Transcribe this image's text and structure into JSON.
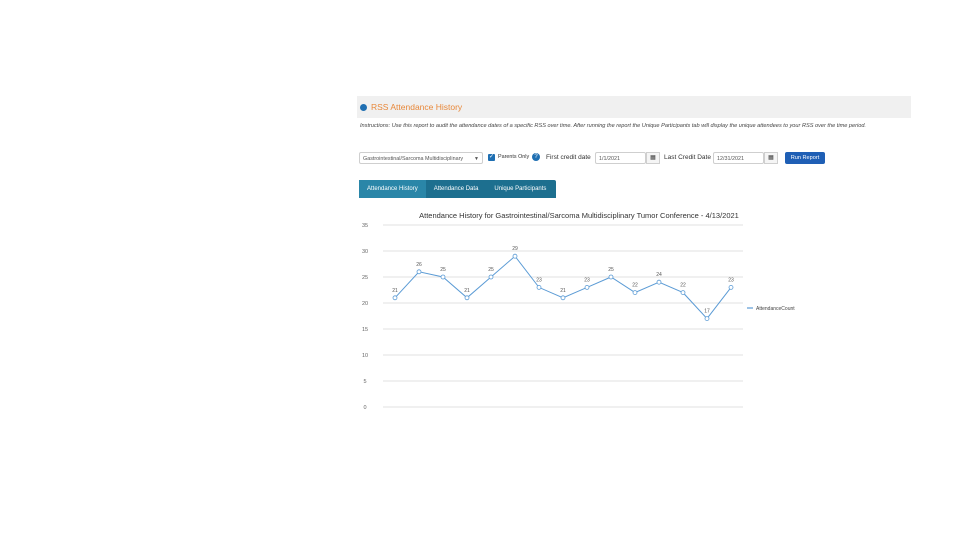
{
  "panel": {
    "title": "RSS Attendance History"
  },
  "instructions": "Instructions: Use this report to audit the attendance dates of a specific RSS over time. After running the report the Unique Participants tab will display the unique attendees to your RSS over the time period.",
  "controls": {
    "series_select_value": "Gastrointestinal/Sarcoma Multidisciplinary",
    "parents_only_label": "Parents Only",
    "parents_only_checked": true,
    "first_credit_label": "First credit date",
    "first_credit_value": "1/1/2021",
    "last_credit_label": "Last Credit Date",
    "last_credit_value": "12/31/2021",
    "run_button_label": "Run Report"
  },
  "tabs": [
    {
      "label": "Attendance History",
      "active": true
    },
    {
      "label": "Attendance Data",
      "active": false
    },
    {
      "label": "Unique Participants",
      "active": false
    }
  ],
  "chart_data": {
    "type": "line",
    "title": "Attendance History for Gastrointestinal/Sarcoma Multidisciplinary Tumor Conference - 4/13/2021",
    "ylim": [
      0,
      35
    ],
    "yticks": [
      0,
      5,
      10,
      15,
      20,
      25,
      30,
      35
    ],
    "grid": true,
    "legend_position": "right",
    "series": [
      {
        "name": "AttendanceCount",
        "values": [
          21,
          26,
          25,
          21,
          25,
          29,
          23,
          21,
          23,
          25,
          22,
          24,
          22,
          17,
          23
        ]
      }
    ],
    "line_color": "#5b9bd5"
  }
}
